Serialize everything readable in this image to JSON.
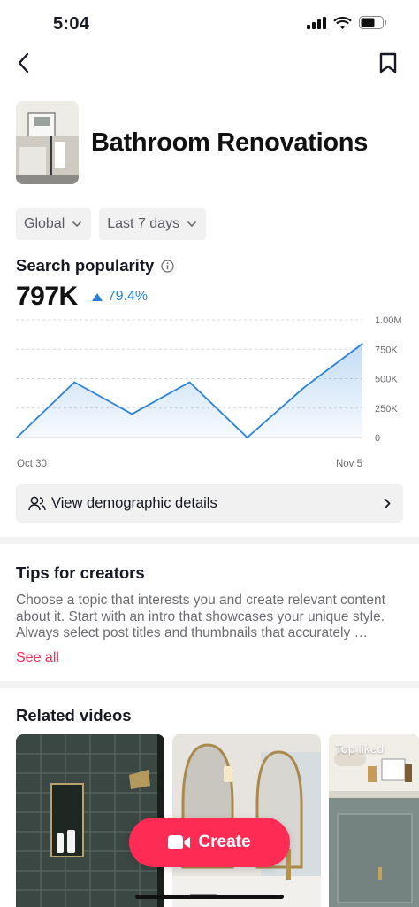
{
  "status_bar": {
    "time": "5:04"
  },
  "header": {
    "title": "Bathroom Renovations"
  },
  "filters": [
    {
      "label": "Global"
    },
    {
      "label": "Last 7 days"
    }
  ],
  "popularity": {
    "title": "Search popularity",
    "value": "797K",
    "change": "79.4%",
    "accent_color": "#2a82d8"
  },
  "chart_data": {
    "type": "area",
    "x": [
      "Oct 30",
      "Oct 31",
      "Nov 1",
      "Nov 2",
      "Nov 3",
      "Nov 4",
      "Nov 5"
    ],
    "series": [
      {
        "values": [
          0,
          470000,
          200000,
          470000,
          0,
          430000,
          797000
        ]
      }
    ],
    "x_tick_labels": [
      "Oct 30",
      "Nov 5"
    ],
    "y_tick_labels": [
      "1.00M",
      "750K",
      "500K",
      "250K",
      "0"
    ],
    "y_ticks": [
      1000000,
      750000,
      500000,
      250000,
      0
    ],
    "ylim": [
      0,
      1000000
    ],
    "grid": true,
    "line_color": "#2a82d8"
  },
  "demographics": {
    "label": "View demographic details"
  },
  "tips": {
    "title": "Tips for creators",
    "body": "Choose a topic that interests you and create relevant content about it. Start with an intro that showcases your unique style. Always select post titles and thumbnails that accurately …",
    "see_all": "See all"
  },
  "related": {
    "title": "Related videos",
    "videos": [
      {
        "badge": ""
      },
      {
        "badge": ""
      },
      {
        "badge": "Top liked"
      }
    ]
  },
  "create_button": {
    "label": "Create",
    "color": "#fe2c55"
  }
}
